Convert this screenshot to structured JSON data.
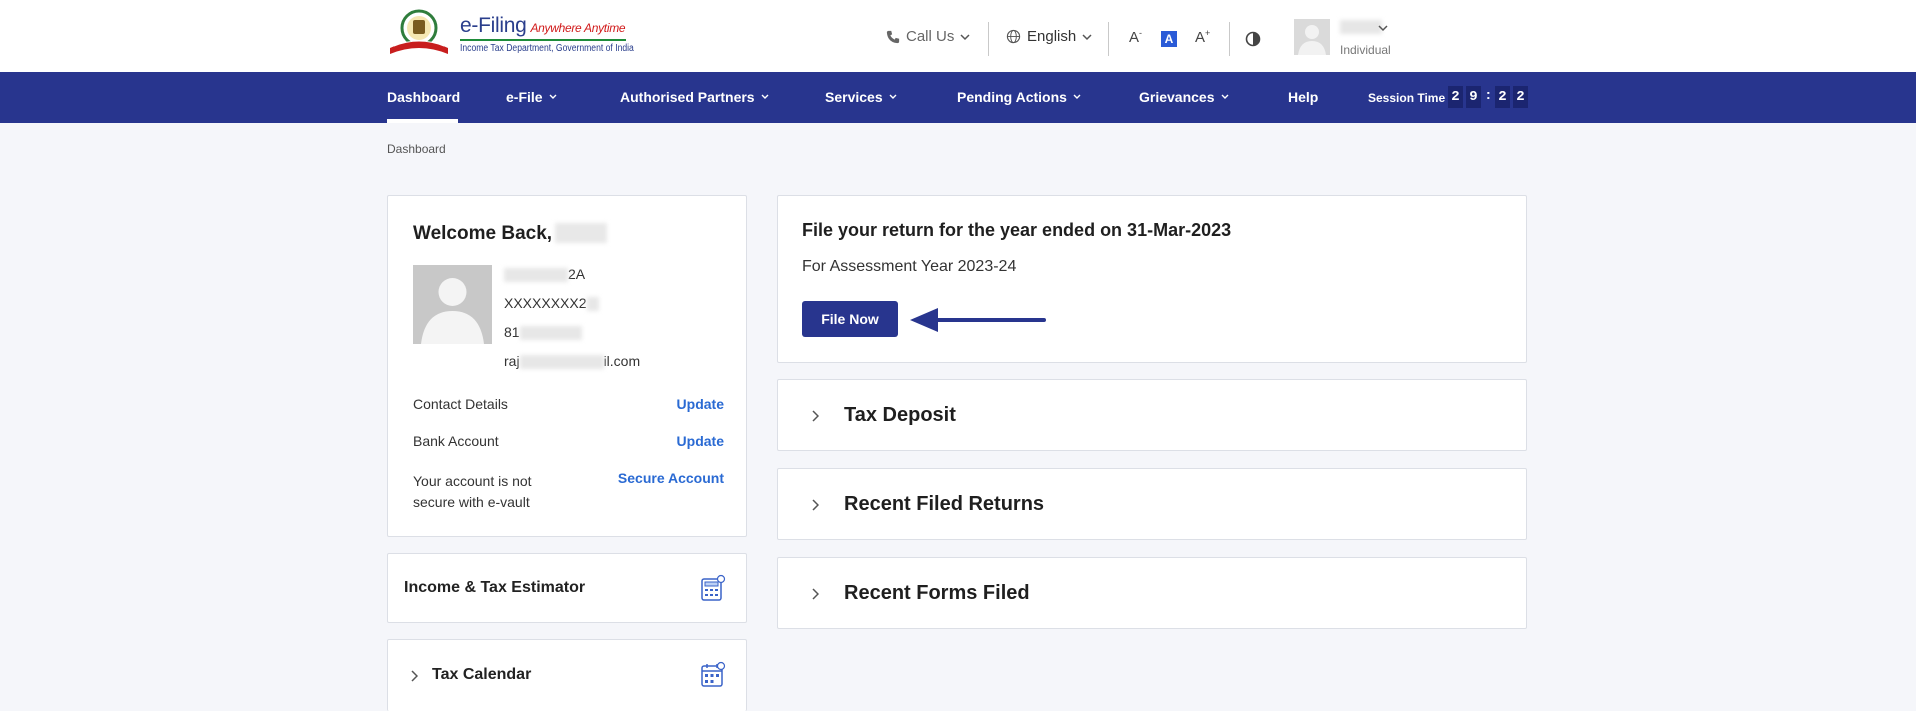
{
  "header": {
    "brand_title": "e-Filing",
    "brand_tagline": "Anywhere Anytime",
    "brand_sub": "Income Tax Department, Government of India",
    "call_us": "Call Us",
    "language": "English",
    "font_decrease": "A",
    "font_normal": "A",
    "font_increase": "A",
    "font_decrease_mark": "-",
    "font_increase_mark": "+",
    "user_role": "Individual"
  },
  "nav": {
    "items": [
      {
        "label": "Dashboard"
      },
      {
        "label": "e-File"
      },
      {
        "label": "Authorised Partners"
      },
      {
        "label": "Services"
      },
      {
        "label": "Pending Actions"
      },
      {
        "label": "Grievances"
      },
      {
        "label": "Help"
      }
    ],
    "session_label": "Session Time",
    "session_digits": [
      "2",
      "9",
      "2",
      "2"
    ],
    "session_separator": ":"
  },
  "breadcrumb": "Dashboard",
  "profile": {
    "welcome": "Welcome Back,",
    "pan_suffix": "2A",
    "aadhaar_prefix": "XXXXXXXX2",
    "mobile_prefix": "81",
    "email_prefix": "raj",
    "email_suffix": "il.com",
    "contact_label": "Contact Details",
    "contact_link": "Update",
    "bank_label": "Bank Account",
    "bank_link": "Update",
    "secure_text": "Your account is not secure with e-vault",
    "secure_link": "Secure Account"
  },
  "estimator": {
    "title": "Income & Tax Estimator"
  },
  "calendar": {
    "title": "Tax Calendar"
  },
  "file_return": {
    "title": "File your return for the year ended on 31-Mar-2023",
    "subtitle": "For Assessment Year 2023-24",
    "button": "File Now"
  },
  "accordions": [
    {
      "title": "Tax Deposit"
    },
    {
      "title": "Recent Filed Returns"
    },
    {
      "title": "Recent Forms Filed"
    }
  ],
  "colors": {
    "nav_bg": "#28358e",
    "link": "#2a6ad3",
    "page_bg": "#f5f6fa"
  }
}
